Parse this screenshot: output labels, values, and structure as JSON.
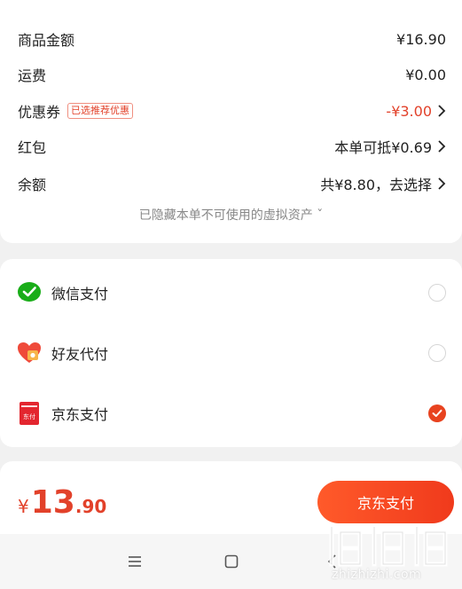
{
  "summary": {
    "goods_amount_label": "商品金额",
    "goods_amount_value": "¥16.90",
    "shipping_label": "运费",
    "shipping_value": "¥0.00",
    "coupon_label": "优惠券",
    "coupon_badge": "已选推荐优惠",
    "coupon_value": "-¥3.00",
    "red_packet_label": "红包",
    "red_packet_value": "本单可抵¥0.69",
    "balance_label": "余额",
    "balance_value": "共¥8.80，去选择",
    "hidden_assets_text": "已隐藏本单不可使用的虚拟资产 ˇ"
  },
  "payment_methods": [
    {
      "label": "微信支付",
      "icon": "wechat-pay-icon",
      "selected": false
    },
    {
      "label": "好友代付",
      "icon": "friend-pay-icon",
      "selected": false
    },
    {
      "label": "京东支付",
      "icon": "jd-pay-icon",
      "icon_text": "东付",
      "selected": true
    }
  ],
  "bottom": {
    "currency": "¥",
    "total_int": "13",
    "total_dec": ".90",
    "pay_button_label": "京东支付"
  },
  "watermark": {
    "text": "zhizhizhi.com",
    "logo_text": "值值值"
  },
  "colors": {
    "accent": "#e8431f",
    "price_red": "#e2412a",
    "wechat_green": "#1aad19"
  }
}
